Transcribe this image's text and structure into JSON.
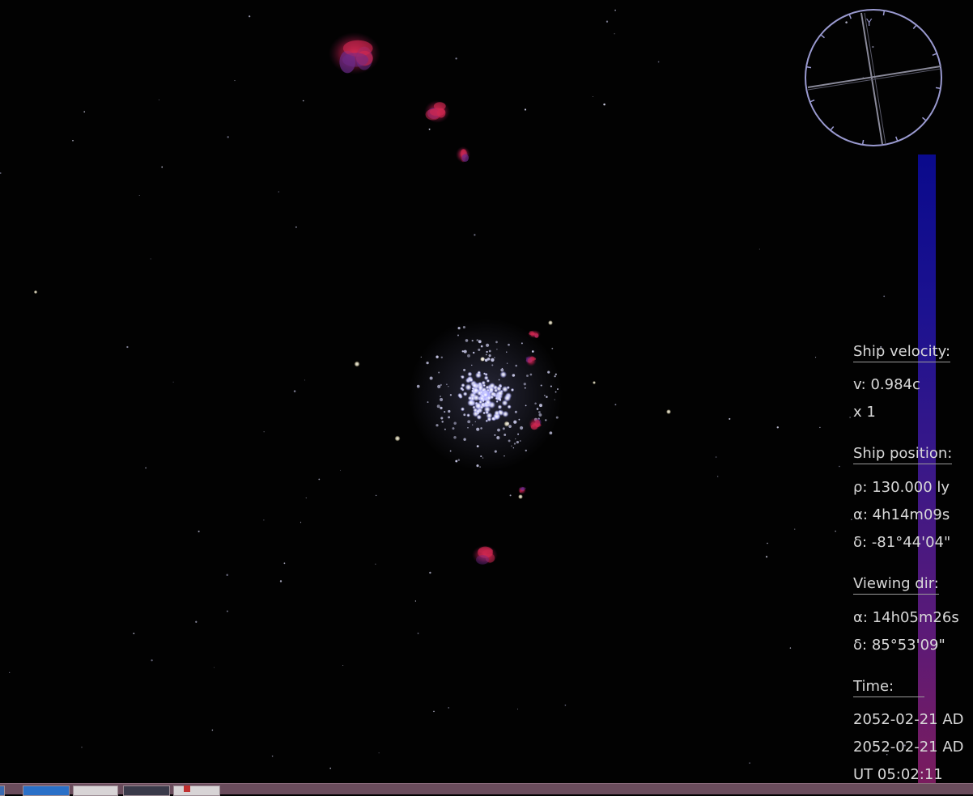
{
  "hud": {
    "velocity_heading": "Ship velocity:",
    "velocity_value": "v: 0.984c",
    "time_factor": "x 1",
    "position_heading": "Ship position:",
    "rho_label": "ρ:",
    "rho_value": "130.000 ly",
    "pos_alpha_label": "α:",
    "pos_alpha_value": "4h14m09s",
    "pos_delta_label": "δ:",
    "pos_delta_value": "-81°44'04\"",
    "view_heading": "Viewing dir:",
    "view_alpha_label": "α:",
    "view_alpha_value": "14h05m26s",
    "view_delta_label": "δ:",
    "view_delta_value": "85°53'09\"",
    "time_heading": "Time:",
    "date_line_1": "2052-02-21 AD",
    "date_line_2": "2052-02-21 AD",
    "ut_line": "UT 05:02:11"
  },
  "compass": {
    "axis_label": "Y"
  },
  "colors": {
    "background": "#020202",
    "hud_text": "#d8d8d8",
    "compass_ring": "#9a9ad0",
    "nebula": "#c0204a",
    "cluster_star": "#dcdcff"
  },
  "taskbar": {
    "buttons": [
      "start-button",
      "explorer-button",
      "window-button",
      "app-button",
      "volume-button"
    ]
  }
}
